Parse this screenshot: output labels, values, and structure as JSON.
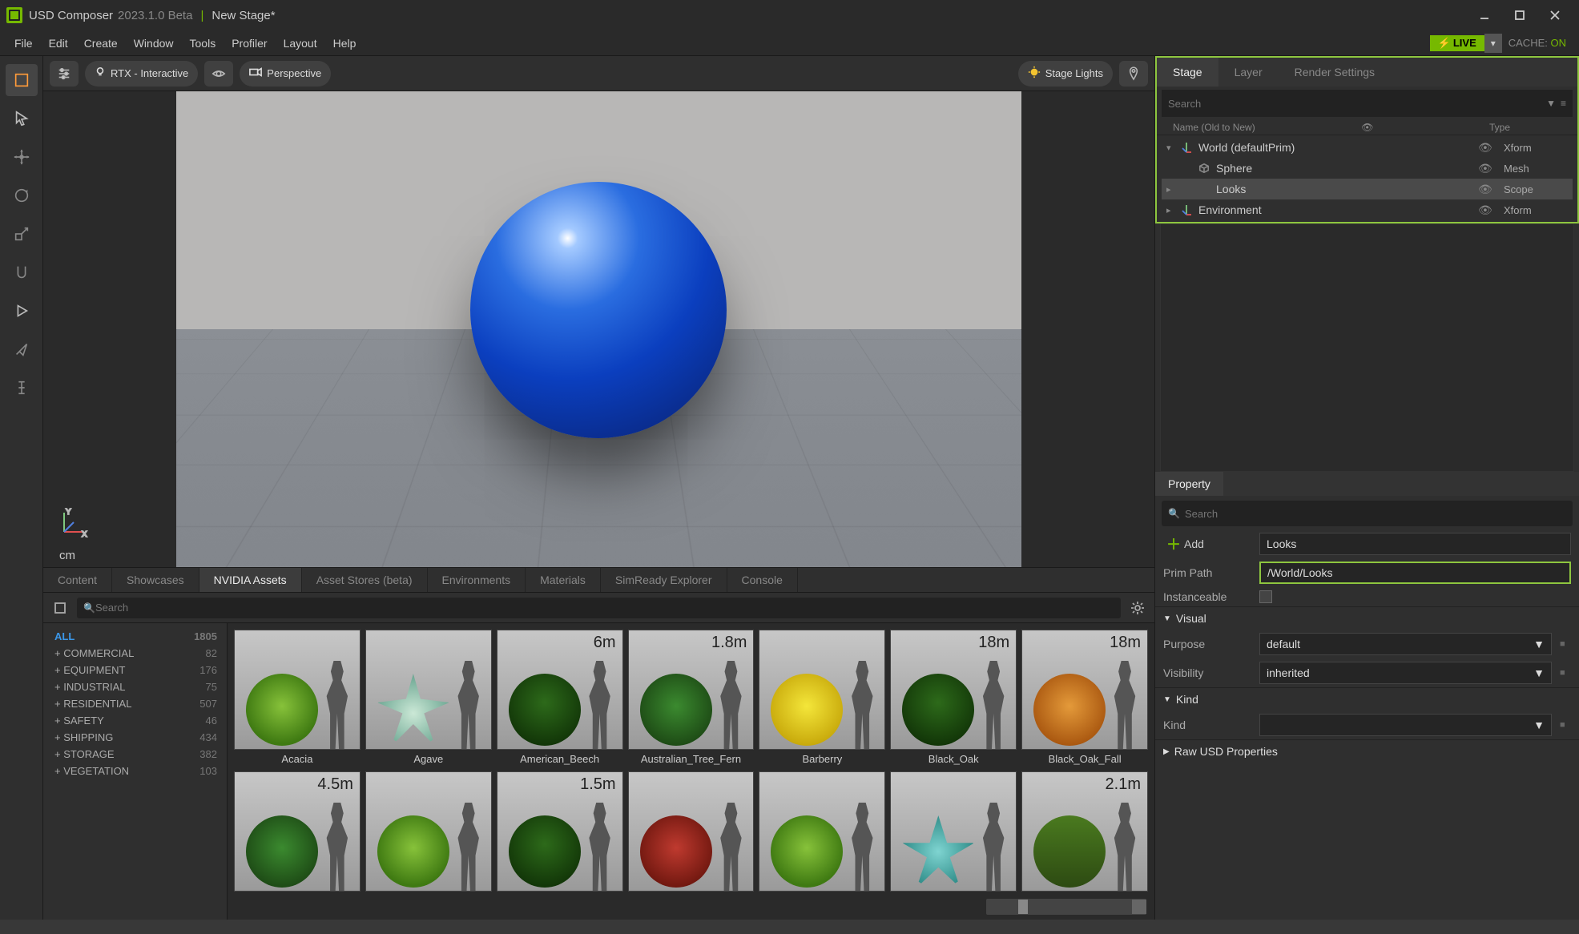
{
  "titlebar": {
    "app_name": "USD Composer",
    "version": "2023.1.0 Beta",
    "stage_name": "New Stage*"
  },
  "menubar": {
    "items": [
      "File",
      "Edit",
      "Create",
      "Window",
      "Tools",
      "Profiler",
      "Layout",
      "Help"
    ],
    "live": "LIVE",
    "cache_label": "CACHE:",
    "cache_state": "ON"
  },
  "viewport_toolbar": {
    "render_mode": "RTX - Interactive",
    "camera": "Perspective",
    "lights": "Stage Lights"
  },
  "viewport": {
    "units": "cm",
    "axes": {
      "up": "Y",
      "right": "X"
    }
  },
  "bottom_tabs": [
    "Content",
    "Showcases",
    "NVIDIA Assets",
    "Asset Stores (beta)",
    "Environments",
    "Materials",
    "SimReady Explorer",
    "Console"
  ],
  "bottom_active_index": 2,
  "asset_search_placeholder": "Search",
  "asset_categories": [
    {
      "name": "ALL",
      "count": 1805,
      "all": true
    },
    {
      "name": "+ COMMERCIAL",
      "count": 82
    },
    {
      "name": "+ EQUIPMENT",
      "count": 176
    },
    {
      "name": "+ INDUSTRIAL",
      "count": 75
    },
    {
      "name": "+ RESIDENTIAL",
      "count": 507
    },
    {
      "name": "+ SAFETY",
      "count": 46
    },
    {
      "name": "+ SHIPPING",
      "count": 434
    },
    {
      "name": "+ STORAGE",
      "count": 382
    },
    {
      "name": "+ VEGETATION",
      "count": 103
    }
  ],
  "assets_row1": [
    {
      "label": "Acacia",
      "dim": "",
      "plant_class": "p-green"
    },
    {
      "label": "Agave",
      "dim": "",
      "plant_class": "p-agave"
    },
    {
      "label": "American_Beech",
      "dim": "6m",
      "plant_class": "p-darkgreen"
    },
    {
      "label": "Australian_Tree_Fern",
      "dim": "1.8m",
      "plant_class": "p-forest"
    },
    {
      "label": "Barberry",
      "dim": "",
      "plant_class": "p-yellow"
    },
    {
      "label": "Black_Oak",
      "dim": "18m",
      "plant_class": "p-darkgreen"
    },
    {
      "label": "Black_Oak_Fall",
      "dim": "18m",
      "plant_class": "p-orange"
    }
  ],
  "assets_row2": [
    {
      "label": "",
      "dim": "4.5m",
      "plant_class": "p-forest"
    },
    {
      "label": "",
      "dim": "",
      "plant_class": "p-green"
    },
    {
      "label": "",
      "dim": "1.5m",
      "plant_class": "p-darkgreen p-small"
    },
    {
      "label": "",
      "dim": "",
      "plant_class": "p-red"
    },
    {
      "label": "",
      "dim": "",
      "plant_class": "p-green p-small"
    },
    {
      "label": "",
      "dim": "",
      "plant_class": "p-teal"
    },
    {
      "label": "",
      "dim": "2.1m",
      "plant_class": "p-tall"
    }
  ],
  "right_tabs": [
    "Stage",
    "Layer",
    "Render Settings"
  ],
  "right_active_index": 0,
  "stage_search_placeholder": "Search",
  "stage_header": {
    "name": "Name (Old to New)",
    "type": "Type"
  },
  "stage_tree": [
    {
      "indent": 0,
      "exp": "▾",
      "icon": "axes",
      "name": "World (defaultPrim)",
      "type": "Xform",
      "selected": false
    },
    {
      "indent": 1,
      "exp": "",
      "icon": "cube",
      "name": "Sphere",
      "type": "Mesh",
      "selected": false
    },
    {
      "indent": 1,
      "exp": "▸",
      "icon": "",
      "name": "Looks",
      "type": "Scope",
      "selected": true
    },
    {
      "indent": 0,
      "exp": "▸",
      "icon": "axes",
      "name": "Environment",
      "type": "Xform",
      "selected": false
    }
  ],
  "property": {
    "panel_title": "Property",
    "search_placeholder": "Search",
    "add_label": "Add",
    "name_value": "Looks",
    "prim_path_label": "Prim Path",
    "prim_path_value": "/World/Looks",
    "instanceable_label": "Instanceable",
    "sections": {
      "visual": "Visual",
      "purpose_label": "Purpose",
      "purpose_value": "default",
      "visibility_label": "Visibility",
      "visibility_value": "inherited",
      "kind": "Kind",
      "kind_label": "Kind",
      "kind_value": "",
      "raw": "Raw USD Properties"
    }
  }
}
